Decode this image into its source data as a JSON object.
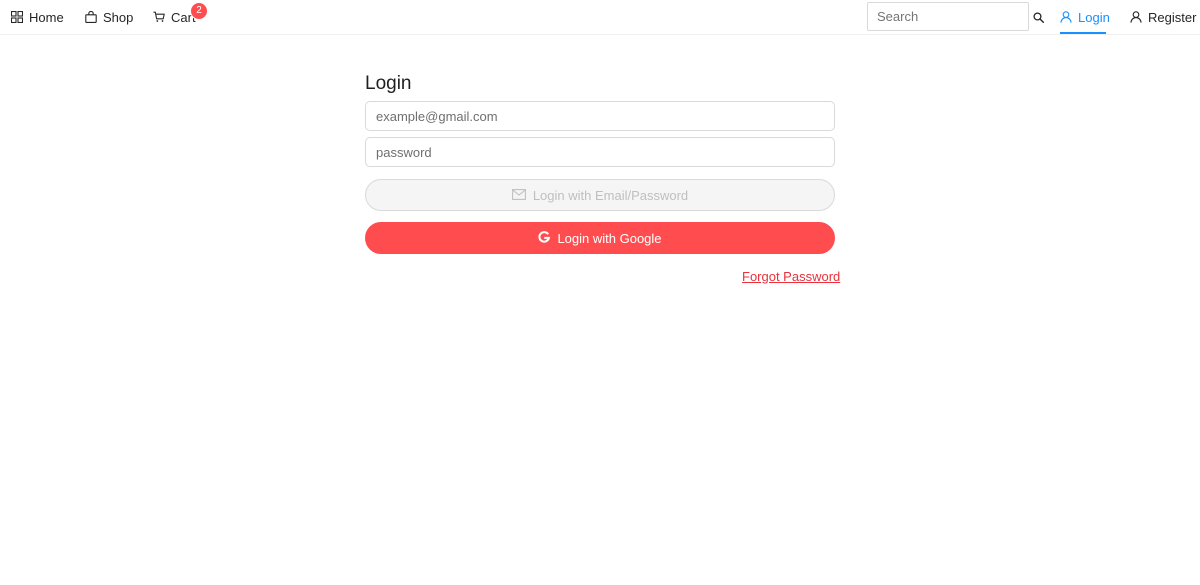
{
  "nav": {
    "home_label": "Home",
    "shop_label": "Shop",
    "cart_label": "Cart",
    "cart_count": "2",
    "search_placeholder": "Search",
    "login_label": "Login",
    "register_label": "Register",
    "active_item": "login",
    "icons": {
      "home": "appstore-icon",
      "shop": "shopping-bag-icon",
      "cart": "shopping-cart-icon",
      "search": "search-icon",
      "login": "user-icon",
      "register": "user-add-icon"
    }
  },
  "form": {
    "title": "Login",
    "email_placeholder": "example@gmail.com",
    "password_placeholder": "password",
    "email_button_label": "Login with Email/Password",
    "email_button_icon": "mail-icon",
    "email_button_disabled": true,
    "google_button_label": "Login with Google",
    "google_button_icon": "google-icon",
    "forgot_label": "Forgot Password"
  },
  "colors": {
    "accent": "#1890ff",
    "danger": "#ff4d4f",
    "link": "#e8323c",
    "disabled_bg": "#f5f5f5",
    "disabled_text": "#bfbfbf"
  }
}
